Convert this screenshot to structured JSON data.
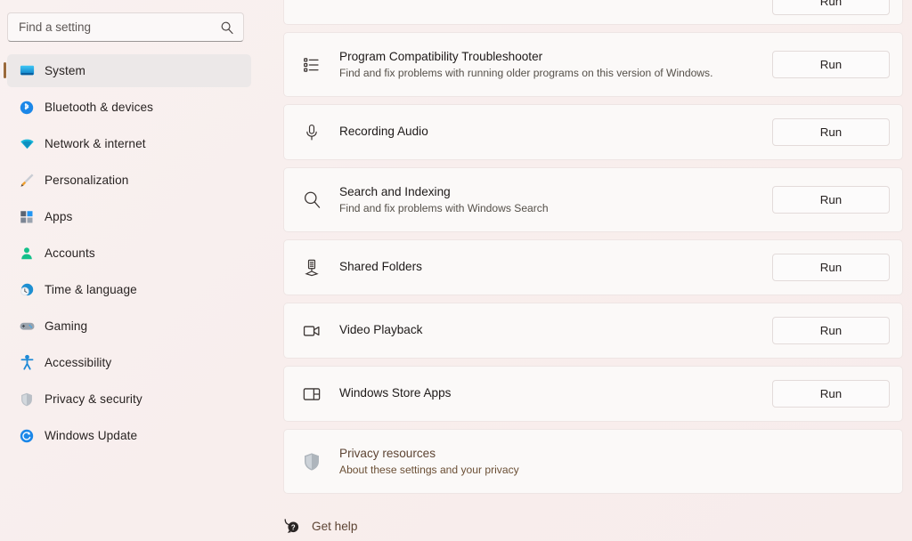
{
  "search": {
    "placeholder": "Find a setting",
    "value": "",
    "icon": "search-icon"
  },
  "sidebar": {
    "items": [
      {
        "label": "System",
        "icon": "monitor-icon",
        "selected": true
      },
      {
        "label": "Bluetooth & devices",
        "icon": "bluetooth-icon",
        "selected": false
      },
      {
        "label": "Network & internet",
        "icon": "wifi-icon",
        "selected": false
      },
      {
        "label": "Personalization",
        "icon": "paintbrush-icon",
        "selected": false
      },
      {
        "label": "Apps",
        "icon": "apps-grid-icon",
        "selected": false
      },
      {
        "label": "Accounts",
        "icon": "person-icon",
        "selected": false
      },
      {
        "label": "Time & language",
        "icon": "clock-globe-icon",
        "selected": false
      },
      {
        "label": "Gaming",
        "icon": "gamepad-icon",
        "selected": false
      },
      {
        "label": "Accessibility",
        "icon": "accessibility-icon",
        "selected": false
      },
      {
        "label": "Privacy & security",
        "icon": "shield-icon",
        "selected": false
      },
      {
        "label": "Windows Update",
        "icon": "update-refresh-icon",
        "selected": false
      }
    ]
  },
  "main": {
    "cards": [
      {
        "clipped": true,
        "title": "",
        "subtitle": "",
        "icon": "",
        "action_label": "Run"
      },
      {
        "title": "Program Compatibility Troubleshooter",
        "subtitle": "Find and fix problems with running older programs on this version of Windows.",
        "icon": "list-icon",
        "action_label": "Run"
      },
      {
        "title": "Recording Audio",
        "subtitle": "",
        "icon": "microphone-icon",
        "action_label": "Run"
      },
      {
        "title": "Search and Indexing",
        "subtitle": "Find and fix problems with Windows Search",
        "icon": "search-icon",
        "action_label": "Run"
      },
      {
        "title": "Shared Folders",
        "subtitle": "",
        "icon": "server-share-icon",
        "action_label": "Run"
      },
      {
        "title": "Video Playback",
        "subtitle": "",
        "icon": "video-camera-icon",
        "action_label": "Run"
      },
      {
        "title": "Windows Store Apps",
        "subtitle": "",
        "icon": "app-window-icon",
        "action_label": "Run"
      }
    ],
    "privacy": {
      "title": "Privacy resources",
      "subtitle": "About these settings and your privacy",
      "icon": "shield-icon"
    },
    "get_help": {
      "label": "Get help",
      "icon": "help-question-icon"
    }
  },
  "colors": {
    "background": "#f8efee",
    "card_background": "#fbf9f8",
    "card_border": "#eee5e4",
    "accent_selection": "#9a6a3c",
    "link_text": "#5d4433",
    "selected_row": "#ece8e8"
  }
}
